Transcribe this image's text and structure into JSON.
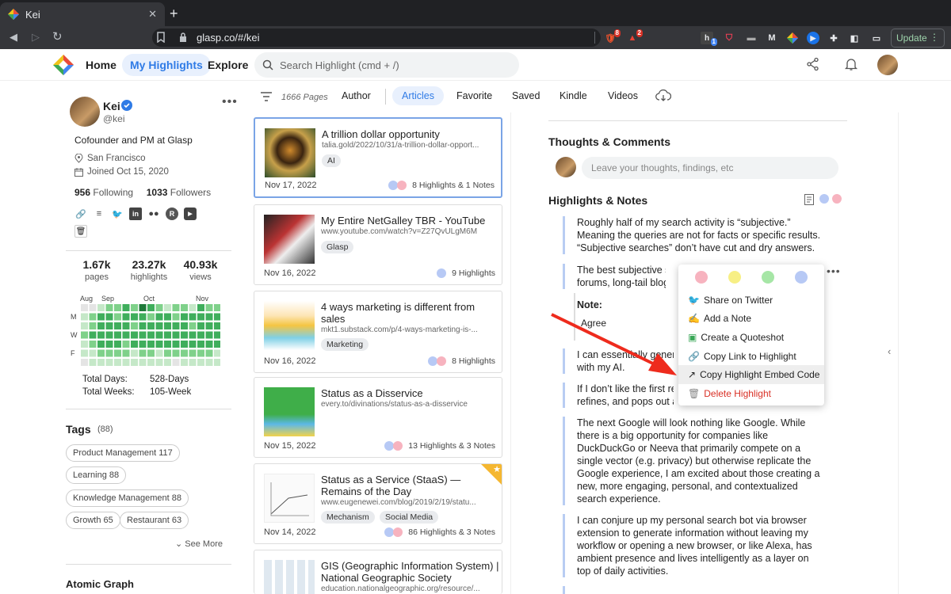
{
  "browser": {
    "tab_title": "Kei",
    "url": "glasp.co/#/kei",
    "update_label": "Update",
    "extensions": [
      {
        "name": "brave-shield-icon",
        "badge": "8"
      },
      {
        "name": "brave-rewards-icon",
        "badge": "2"
      },
      {
        "name": "highlighter-ext-icon",
        "badge": "1"
      },
      {
        "name": "pocket-icon"
      },
      {
        "name": "medium-icon",
        "label": "M"
      },
      {
        "name": "glasp-ext-icon"
      },
      {
        "name": "cast-icon"
      },
      {
        "name": "puzzle-icon"
      },
      {
        "name": "sidebar-icon"
      },
      {
        "name": "wallet-icon"
      }
    ]
  },
  "header": {
    "nav": [
      "Home",
      "My Highlights",
      "Explore"
    ],
    "search_placeholder": "Search Highlight (cmd + /)"
  },
  "profile": {
    "name": "Kei",
    "handle": "@kei",
    "bio": "Cofounder and PM at Glasp",
    "location": "San Francisco",
    "joined": "Joined Oct 15, 2020",
    "following_count": "956",
    "following_label": "Following",
    "followers_count": "1033",
    "followers_label": "Followers",
    "stats": [
      {
        "value": "1.67k",
        "label": "pages"
      },
      {
        "value": "23.27k",
        "label": "highlights"
      },
      {
        "value": "40.93k",
        "label": "views"
      }
    ],
    "months": [
      "Aug",
      "Sep",
      "Oct",
      "Nov"
    ],
    "days": [
      "M",
      "W",
      "F"
    ],
    "total_days_label": "Total Days:",
    "total_days_value": "528-Days",
    "total_weeks_label": "Total Weeks:",
    "total_weeks_value": "105-Week"
  },
  "tags": {
    "title": "Tags",
    "count": "(88)",
    "items": [
      "Product Management 117",
      "Learning 88",
      "Knowledge Management 88",
      "Growth 65",
      "Restaurant 63"
    ],
    "see_more": "See More"
  },
  "atomic_graph": "Atomic Graph",
  "filter": {
    "pages": "1666 Pages",
    "tabs": [
      "Author",
      "Articles",
      "Favorite",
      "Saved",
      "Kindle",
      "Videos"
    ],
    "active": "Articles"
  },
  "cards": [
    {
      "title": "A trillion dollar opportunity",
      "url": "talia.gold/2022/10/31/a-trillion-dollar-opport...",
      "tags": [
        "AI"
      ],
      "date": "Nov 17, 2022",
      "stats": "8 Highlights & 1 Notes"
    },
    {
      "title": "My Entire NetGalley TBR - YouTube",
      "url": "www.youtube.com/watch?v=Z27QvULgM6M",
      "tags": [
        "Glasp"
      ],
      "date": "Nov 16, 2022",
      "stats": "9 Highlights"
    },
    {
      "title": "4 ways marketing is different from sales",
      "url": "mkt1.substack.com/p/4-ways-marketing-is-...",
      "tags": [
        "Marketing"
      ],
      "date": "Nov 16, 2022",
      "stats": "8 Highlights"
    },
    {
      "title": "Status as a Disservice",
      "url": "every.to/divinations/status-as-a-disservice",
      "tags": [],
      "date": "Nov 15, 2022",
      "stats": "13 Highlights & 3 Notes"
    },
    {
      "title": "Status as a Service (StaaS) — Remains of the Day",
      "url": "www.eugenewei.com/blog/2019/2/19/statu...",
      "tags": [
        "Mechanism",
        "Social Media"
      ],
      "date": "Nov 14, 2022",
      "stats": "86 Highlights & 3 Notes"
    },
    {
      "title": "GIS (Geographic Information System) | National Geographic Society",
      "url": "education.nationalgeographic.org/resource/...",
      "tags": [],
      "date": "",
      "stats": ""
    }
  ],
  "right": {
    "thoughts_title": "Thoughts & Comments",
    "comment_placeholder": "Leave your thoughts, findings, etc",
    "highlights_title": "Highlights & Notes",
    "highlights": [
      "Roughly half of my search activity is “subjective.” Meaning the queries are not for facts or specific results. “Subjective searches” don’t have cut and dry answers.",
      "The best subjective sea",
      "forums, long-tail blogs,",
      "I can essentially genera",
      "with my AI.",
      "If I don’t like the first re",
      "refines, and pops out a",
      "The next Google will look nothing like Google. While there is a big opportunity for companies like DuckDuckGo or Neeva that primarily compete on a single vector (e.g. privacy) but otherwise replicate the Google experience, I am excited about those creating a new, more engaging, personal, and contextualized search experience.",
      "I can conjure up my personal search bot via browser extension to generate information without leaving my workflow or opening a new browser, or like Alexa, has ambient presence and lives intelligently as a layer on top of daily activities."
    ],
    "note_label": "Note:",
    "note_text": "Agree"
  },
  "context_menu": {
    "colors": [
      "#f7b3bf",
      "#f7ef85",
      "#a6e6a6",
      "#b7c9f5"
    ],
    "items": [
      {
        "label": "Share on Twitter",
        "icon": "twitter-icon"
      },
      {
        "label": "Add a Note",
        "icon": "pencil-icon"
      },
      {
        "label": "Create a Quoteshot",
        "icon": "picture-icon"
      },
      {
        "label": "Copy Link to Highlight",
        "icon": "link-icon"
      },
      {
        "label": "Copy Highlight Embed Code",
        "icon": "embed-icon"
      },
      {
        "label": "Delete Highlight",
        "icon": "trash-icon"
      }
    ]
  },
  "colors": {
    "accent": "#2f7be6",
    "danger": "#d93025",
    "arrow": "#ee2b1d",
    "star": "#f5b731"
  }
}
